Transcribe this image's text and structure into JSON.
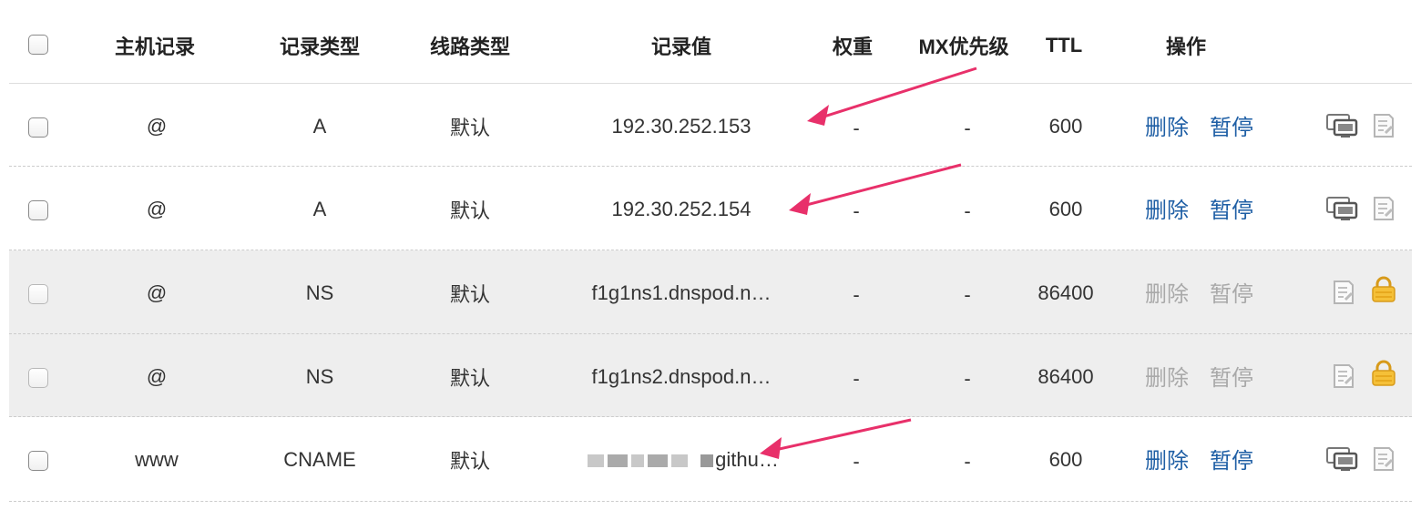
{
  "header": {
    "host": "主机记录",
    "type": "记录类型",
    "line": "线路类型",
    "value": "记录值",
    "weight": "权重",
    "mx": "MX优先级",
    "ttl": "TTL",
    "ops": "操作"
  },
  "rows": [
    {
      "host": "@",
      "type": "A",
      "line": "默认",
      "value": "192.30.252.153",
      "weight": "-",
      "mx": "-",
      "ttl": "600",
      "delete": "删除",
      "pause": "暂停",
      "locked": false
    },
    {
      "host": "@",
      "type": "A",
      "line": "默认",
      "value": "192.30.252.154",
      "weight": "-",
      "mx": "-",
      "ttl": "600",
      "delete": "删除",
      "pause": "暂停",
      "locked": false
    },
    {
      "host": "@",
      "type": "NS",
      "line": "默认",
      "value": "f1g1ns1.dnspod.n…",
      "weight": "-",
      "mx": "-",
      "ttl": "86400",
      "delete": "删除",
      "pause": "暂停",
      "locked": true
    },
    {
      "host": "@",
      "type": "NS",
      "line": "默认",
      "value": "f1g1ns2.dnspod.n…",
      "weight": "-",
      "mx": "-",
      "ttl": "86400",
      "delete": "删除",
      "pause": "暂停",
      "locked": true
    },
    {
      "host": "www",
      "type": "CNAME",
      "line": "默认",
      "value": "githu…",
      "weight": "-",
      "mx": "-",
      "ttl": "600",
      "delete": "删除",
      "pause": "暂停",
      "locked": false
    }
  ],
  "icons": {
    "monitor": "monitor-icon",
    "note": "note-icon",
    "lock": "lock-icon"
  },
  "colors": {
    "link": "#1f5fa5",
    "disabled": "#a9a9a9",
    "arrow": "#e8306a",
    "locked_row_bg": "#eeeeee",
    "lock": "#f2b830"
  }
}
